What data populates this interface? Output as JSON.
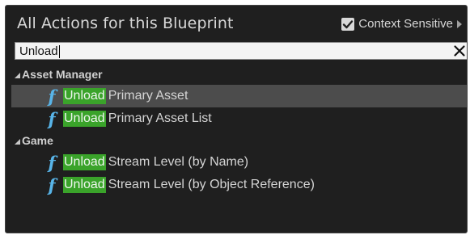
{
  "header": {
    "title": "All Actions for this Blueprint",
    "context_sensitive_label": "Context Sensitive",
    "context_sensitive_checked": true
  },
  "search": {
    "value": "Unload",
    "clear_icon": "close-icon"
  },
  "categories": [
    {
      "label": "Asset Manager",
      "items": [
        {
          "match": "Unload",
          "rest": "Primary Asset",
          "icon": "function-icon",
          "selected": true
        },
        {
          "match": "Unload",
          "rest": "Primary Asset List",
          "icon": "function-icon",
          "selected": false
        }
      ]
    },
    {
      "label": "Game",
      "items": [
        {
          "match": "Unload",
          "rest": "Stream Level (by Name)",
          "icon": "function-icon",
          "selected": false
        },
        {
          "match": "Unload",
          "rest": "Stream Level (by Object Reference)",
          "icon": "function-icon",
          "selected": false
        }
      ]
    }
  ],
  "colors": {
    "panel_bg": "#1f1f1f",
    "selected_row": "#4c4c4c",
    "match_highlight": "#3aa32a",
    "function_icon": "#58b4e8"
  }
}
